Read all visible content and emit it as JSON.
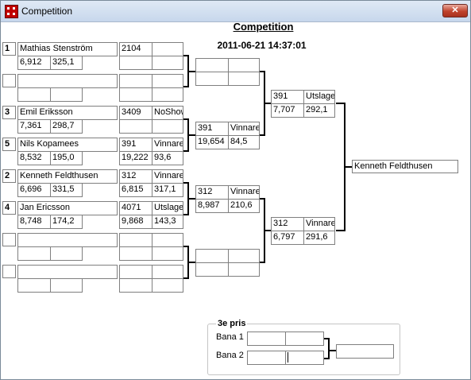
{
  "window": {
    "title": "Competition",
    "close_symbol": "✕"
  },
  "header": {
    "title": "Competition",
    "datetime": "2011-06-21 14:37:01"
  },
  "round1": [
    {
      "seed": "1",
      "name": "Mathias Stenström",
      "v1": "6,912",
      "v2": "325,1"
    },
    {
      "seed": "",
      "name": "",
      "v1": "",
      "v2": ""
    },
    {
      "seed": "3",
      "name": "Emil Eriksson",
      "v1": "7,361",
      "v2": "298,7"
    },
    {
      "seed": "5",
      "name": "Nils Kopamees",
      "v1": "8,532",
      "v2": "195,0"
    },
    {
      "seed": "2",
      "name": "Kenneth Feldthusen",
      "v1": "6,696",
      "v2": "331,5"
    },
    {
      "seed": "4",
      "name": "Jan Ericsson",
      "v1": "8,748",
      "v2": "174,2"
    },
    {
      "seed": "",
      "name": "",
      "v1": "",
      "v2": ""
    },
    {
      "seed": "",
      "name": "",
      "v1": "",
      "v2": ""
    }
  ],
  "round2": [
    {
      "id": "2104",
      "status": "",
      "v1": "",
      "v2": ""
    },
    {
      "id": "",
      "status": "",
      "v1": "",
      "v2": ""
    },
    {
      "id": "3409",
      "status": "NoShow",
      "v1": "",
      "v2": ""
    },
    {
      "id": "391",
      "status": "Vinnare",
      "v1": "19,222",
      "v2": "93,6"
    },
    {
      "id": "312",
      "status": "Vinnare",
      "v1": "6,815",
      "v2": "317,1"
    },
    {
      "id": "4071",
      "status": "Utslagen",
      "v1": "9,868",
      "v2": "143,3"
    },
    {
      "id": "",
      "status": "",
      "v1": "",
      "v2": ""
    },
    {
      "id": "",
      "status": "",
      "v1": "",
      "v2": ""
    }
  ],
  "round3": [
    {
      "id": "",
      "status": "",
      "v1": "",
      "v2": ""
    },
    {
      "id": "391",
      "status": "Vinnare",
      "v1": "19,654",
      "v2": "84,5"
    },
    {
      "id": "312",
      "status": "Vinnare",
      "v1": "8,987",
      "v2": "210,6"
    },
    {
      "id": "",
      "status": "",
      "v1": "",
      "v2": ""
    }
  ],
  "semis": [
    {
      "id": "391",
      "status": "Utslagen",
      "v1": "7,707",
      "v2": "292,1"
    },
    {
      "id": "312",
      "status": "Vinnare",
      "v1": "6,797",
      "v2": "291,6"
    }
  ],
  "winner": "Kenneth Feldthusen",
  "third_place": {
    "label": "3e pris",
    "lane1": "Bana 1",
    "lane2": "Bana 2",
    "result": ""
  }
}
